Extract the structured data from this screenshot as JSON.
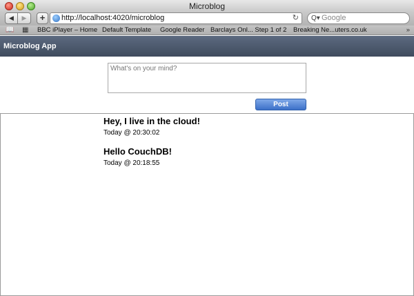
{
  "window": {
    "title": "Microblog"
  },
  "toolbar": {
    "back_glyph": "◀",
    "forward_glyph": "▶",
    "add_glyph": "+",
    "url": "http://localhost:4020/microblog",
    "reload_glyph": "↻",
    "search_placeholder": "Google",
    "search_glyph": "Q▾"
  },
  "bookmarks": {
    "book_glyph": "📖",
    "grid_glyph": "▦",
    "items": [
      "BBC iPlayer – Home",
      "Default Template",
      "Google Reader",
      "Barclays Onl... Step 1 of 2",
      "Breaking Ne...uters.co.uk"
    ],
    "more_glyph": "»"
  },
  "app": {
    "name": "Microblog App",
    "composer_placeholder": "What's on your mind?",
    "post_label": "Post"
  },
  "posts": [
    {
      "title": "Hey, I live in the cloud!",
      "time": "Today @ 20:30:02"
    },
    {
      "title": "Hello CouchDB!",
      "time": "Today @ 20:18:55"
    }
  ],
  "colors": {
    "header": "#4d5a6e",
    "post_button": "#3c70c8"
  }
}
